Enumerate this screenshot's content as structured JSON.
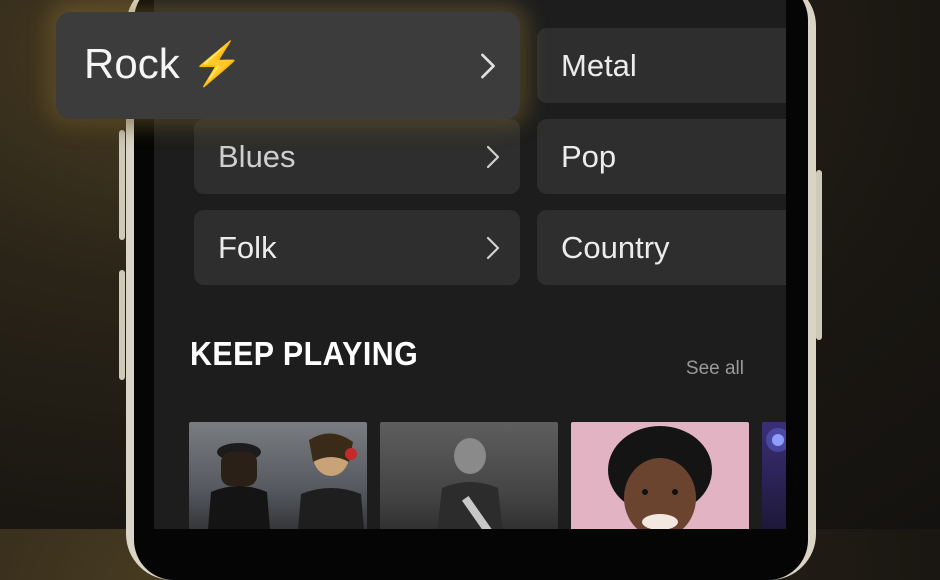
{
  "featured_genre": {
    "label": "Rock",
    "emoji": "⚡"
  },
  "genres": [
    {
      "label": "Metal",
      "has_chevron": false
    },
    {
      "label": "Blues",
      "has_chevron": true
    },
    {
      "label": "Pop",
      "has_chevron": false
    },
    {
      "label": "Folk",
      "has_chevron": true
    },
    {
      "label": "Country",
      "has_chevron": false
    }
  ],
  "keep_playing": {
    "title": "KEEP PLAYING",
    "see_all": "See all"
  },
  "albums": [
    {
      "name": "rock-band-live-photo",
      "bg": "#6b6e72"
    },
    {
      "name": "guitarist-bw-photo",
      "bg": "#505050"
    },
    {
      "name": "soul-singer-portrait",
      "bg": "#d9a9b8"
    },
    {
      "name": "concert-stage-photo",
      "bg": "#2a2960"
    }
  ]
}
